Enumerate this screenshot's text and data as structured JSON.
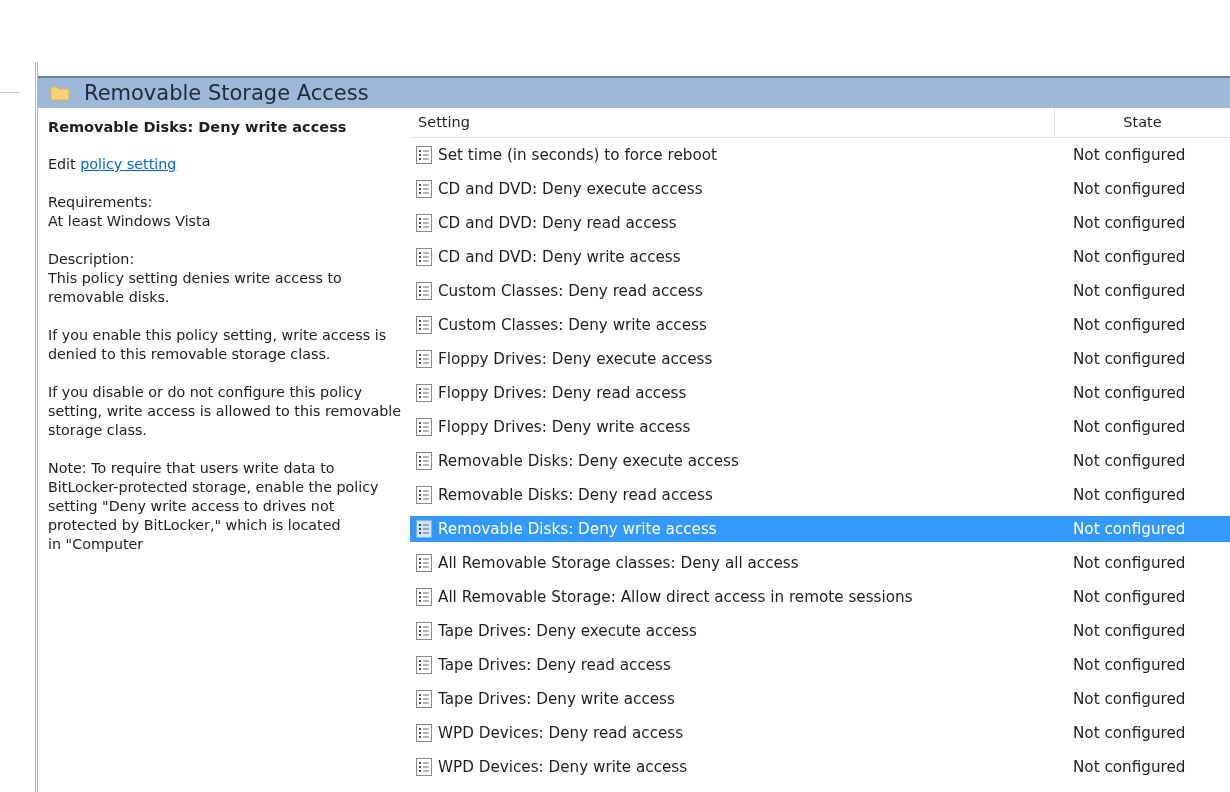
{
  "window": {
    "title": "Removable Storage Access"
  },
  "description": {
    "heading": "Removable Disks: Deny write access",
    "edit_prefix": "Edit",
    "edit_link": "policy setting",
    "paragraphs": [
      "Requirements:\nAt least Windows Vista",
      "Description:\nThis policy setting denies write access to removable disks.",
      "If you enable this policy setting, write access is denied to this removable storage class.",
      "If you disable or do not configure this policy setting, write access is allowed to this removable storage class.",
      "Note: To require that users write data to BitLocker-protected storage, enable the policy setting \"Deny write access to drives not protected by BitLocker,\" which is located\nin \"Computer"
    ]
  },
  "table": {
    "columns": [
      "Setting",
      "State"
    ],
    "rows": [
      {
        "setting": "Set time (in seconds) to force reboot",
        "state": "Not configured",
        "selected": false
      },
      {
        "setting": "CD and DVD: Deny execute access",
        "state": "Not configured",
        "selected": false
      },
      {
        "setting": "CD and DVD: Deny read access",
        "state": "Not configured",
        "selected": false
      },
      {
        "setting": "CD and DVD: Deny write access",
        "state": "Not configured",
        "selected": false
      },
      {
        "setting": "Custom Classes: Deny read access",
        "state": "Not configured",
        "selected": false
      },
      {
        "setting": "Custom Classes: Deny write access",
        "state": "Not configured",
        "selected": false
      },
      {
        "setting": "Floppy Drives: Deny execute access",
        "state": "Not configured",
        "selected": false
      },
      {
        "setting": "Floppy Drives: Deny read access",
        "state": "Not configured",
        "selected": false
      },
      {
        "setting": "Floppy Drives: Deny write access",
        "state": "Not configured",
        "selected": false
      },
      {
        "setting": "Removable Disks: Deny execute access",
        "state": "Not configured",
        "selected": false
      },
      {
        "setting": "Removable Disks: Deny read access",
        "state": "Not configured",
        "selected": false
      },
      {
        "setting": "Removable Disks: Deny write access",
        "state": "Not configured",
        "selected": true
      },
      {
        "setting": "All Removable Storage classes: Deny all access",
        "state": "Not configured",
        "selected": false
      },
      {
        "setting": "All Removable Storage: Allow direct access in remote sessions",
        "state": "Not configured",
        "selected": false
      },
      {
        "setting": "Tape Drives: Deny execute access",
        "state": "Not configured",
        "selected": false
      },
      {
        "setting": "Tape Drives: Deny read access",
        "state": "Not configured",
        "selected": false
      },
      {
        "setting": "Tape Drives: Deny write access",
        "state": "Not configured",
        "selected": false
      },
      {
        "setting": "WPD Devices: Deny read access",
        "state": "Not configured",
        "selected": false
      },
      {
        "setting": "WPD Devices: Deny write access",
        "state": "Not configured",
        "selected": false
      }
    ]
  }
}
